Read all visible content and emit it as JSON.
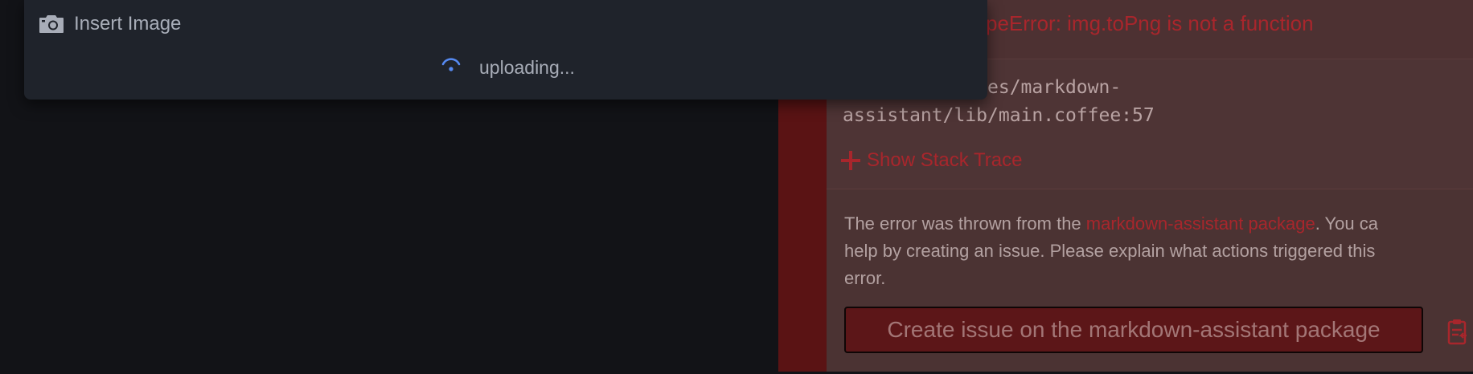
{
  "dialog": {
    "title": "Insert Image",
    "status": "uploading...",
    "icons": {
      "title_icon": "camera-icon",
      "status_icon": "spinner-icon"
    }
  },
  "notification": {
    "message": "peError: img.toPng is not a function",
    "detail_lines": [
      "/.atom/packages/markdown-",
      "assistant/lib/main.coffee:57"
    ],
    "stack_toggle": "Show Stack Trace",
    "description": {
      "before_link": "The error was thrown from the ",
      "link": "markdown-assistant package",
      "after_link": ". You ca",
      "line2": "help by creating an issue. Please explain what actions triggered this",
      "line3": "error."
    },
    "create_issue_button": "Create issue on the markdown-assistant package",
    "icons": {
      "toggle_icon": "plus-icon",
      "copy_icon": "clipboard-icon"
    }
  },
  "colors": {
    "editor_background": "#121317",
    "dialog_background": "#1f232b",
    "error_accent": "#a8262c",
    "notification_background": "#4b3333",
    "spinner": "#568af2"
  }
}
